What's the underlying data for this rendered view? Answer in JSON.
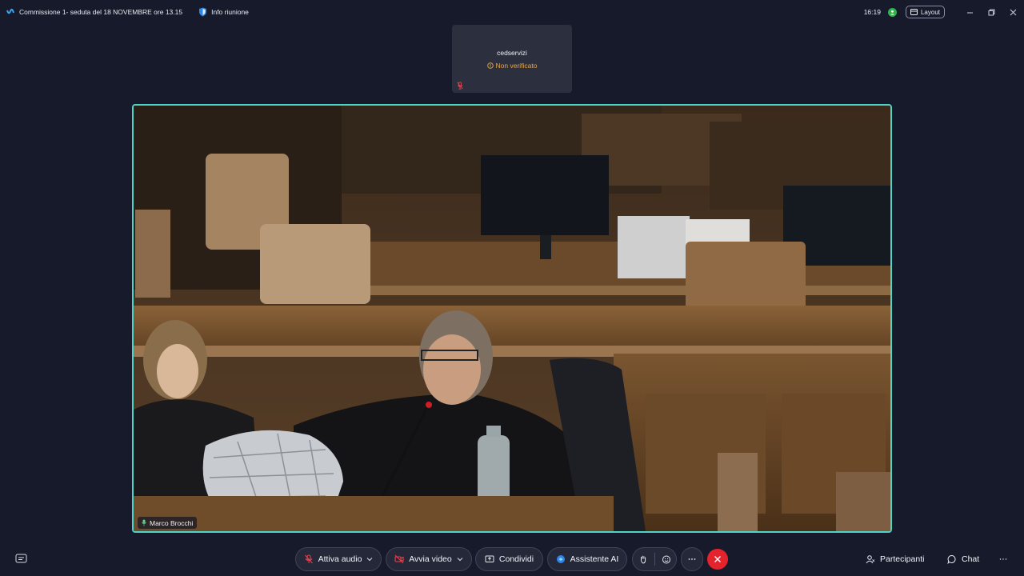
{
  "titlebar": {
    "meeting_title": "Commissione 1- seduta del 18 NOVEMBRE ore 13.15",
    "info_label": "Info riunione",
    "clock": "16:19",
    "layout_label": "Layout"
  },
  "participant_tile": {
    "name": "cedservizi",
    "status": "Non verificato"
  },
  "main_video": {
    "speaker_name": "Marco Brocchi"
  },
  "toolbar": {
    "audio_label": "Attiva audio",
    "video_label": "Avvia video",
    "share_label": "Condividi",
    "ai_label": "Assistente AI",
    "participants_label": "Partecipanti",
    "chat_label": "Chat"
  },
  "colors": {
    "background": "#161a2b",
    "active_speaker_border": "#4fd3c4",
    "end_call": "#e5232c",
    "warning": "#e3a64c",
    "presence": "#2fb34a"
  },
  "icons": [
    "webex-logo-icon",
    "shield-icon",
    "presence-icon",
    "layout-icon",
    "minimize-icon",
    "restore-icon",
    "close-icon",
    "warning-icon",
    "mic-muted-icon",
    "mic-icon",
    "captions-icon",
    "video-off-icon",
    "share-icon",
    "ai-assistant-icon",
    "raise-hand-icon",
    "reactions-icon",
    "more-icon",
    "end-call-icon",
    "participants-icon",
    "chat-icon"
  ]
}
